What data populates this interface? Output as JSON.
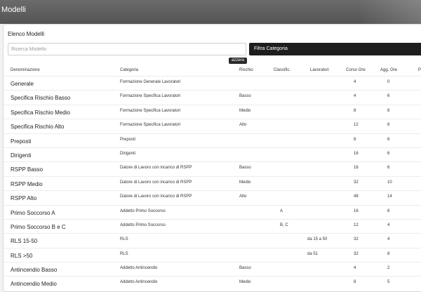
{
  "window": {
    "title": "Modelli"
  },
  "panel": {
    "title": "Elenco Modelli",
    "search_placeholder": "Ricerca Modello",
    "filter_label": "Filtra Categoria",
    "reset_label": "azzera"
  },
  "columns": [
    "Denominazione",
    "Categoria",
    "Rischio",
    "Classific.",
    "Lavoratori",
    "Corso Ore",
    "Agg. Ore",
    "P"
  ],
  "rows": [
    {
      "name": "Generale",
      "category": "Formazione Generale Lavoratori",
      "risk": "",
      "class": "",
      "workers": "",
      "hours": "4",
      "upd_hours": "0"
    },
    {
      "name": "Specifica Rischio Basso",
      "category": "Formazione Specifica Lavoratori",
      "risk": "Basso",
      "class": "",
      "workers": "",
      "hours": "4",
      "upd_hours": "6"
    },
    {
      "name": "Specifica Rischio Medio",
      "category": "Formazione Specifica Lavoratori",
      "risk": "Medio",
      "class": "",
      "workers": "",
      "hours": "8",
      "upd_hours": "6"
    },
    {
      "name": "Specifica Rischio Alto",
      "category": "Formazione Specifica Lavoratori",
      "risk": "Alto",
      "class": "",
      "workers": "",
      "hours": "12",
      "upd_hours": "6"
    },
    {
      "name": "Preposti",
      "category": "Preposti",
      "risk": "",
      "class": "",
      "workers": "",
      "hours": "8",
      "upd_hours": "6"
    },
    {
      "name": "Dirigenti",
      "category": "Dirigenti",
      "risk": "",
      "class": "",
      "workers": "",
      "hours": "16",
      "upd_hours": "6"
    },
    {
      "name": "RSPP Basso",
      "category": "Datore di Lavoro con incarico di RSPP",
      "risk": "Basso",
      "class": "",
      "workers": "",
      "hours": "16",
      "upd_hours": "6"
    },
    {
      "name": "RSPP Medio",
      "category": "Datore di Lavoro con incarico di RSPP",
      "risk": "Medio",
      "class": "",
      "workers": "",
      "hours": "32",
      "upd_hours": "10"
    },
    {
      "name": "RSPP Alto",
      "category": "Datore di Lavoro con incarico di RSPP",
      "risk": "Alto",
      "class": "",
      "workers": "",
      "hours": "48",
      "upd_hours": "14"
    },
    {
      "name": "Primo Soccorso A",
      "category": "Addetto Primo Soccorso",
      "risk": "",
      "class": "A",
      "workers": "",
      "hours": "16",
      "upd_hours": "6"
    },
    {
      "name": "Primo Soccorso B e C",
      "category": "Addetto Primo Soccorso",
      "risk": "",
      "class": "B, C",
      "workers": "",
      "hours": "12",
      "upd_hours": "4"
    },
    {
      "name": "RLS 15-50",
      "category": "RLS",
      "risk": "",
      "class": "",
      "workers": "da 15 a 50",
      "hours": "32",
      "upd_hours": "4"
    },
    {
      "name": "RLS >50",
      "category": "RLS",
      "risk": "",
      "class": "",
      "workers": "da 51",
      "hours": "32",
      "upd_hours": "8"
    },
    {
      "name": "Antincendio Basso",
      "category": "Addetto Antincendio",
      "risk": "Basso",
      "class": "",
      "workers": "",
      "hours": "4",
      "upd_hours": "2"
    },
    {
      "name": "Antincendio Medio",
      "category": "Addetto Antincendio",
      "risk": "Medio",
      "class": "",
      "workers": "",
      "hours": "8",
      "upd_hours": "5"
    }
  ]
}
